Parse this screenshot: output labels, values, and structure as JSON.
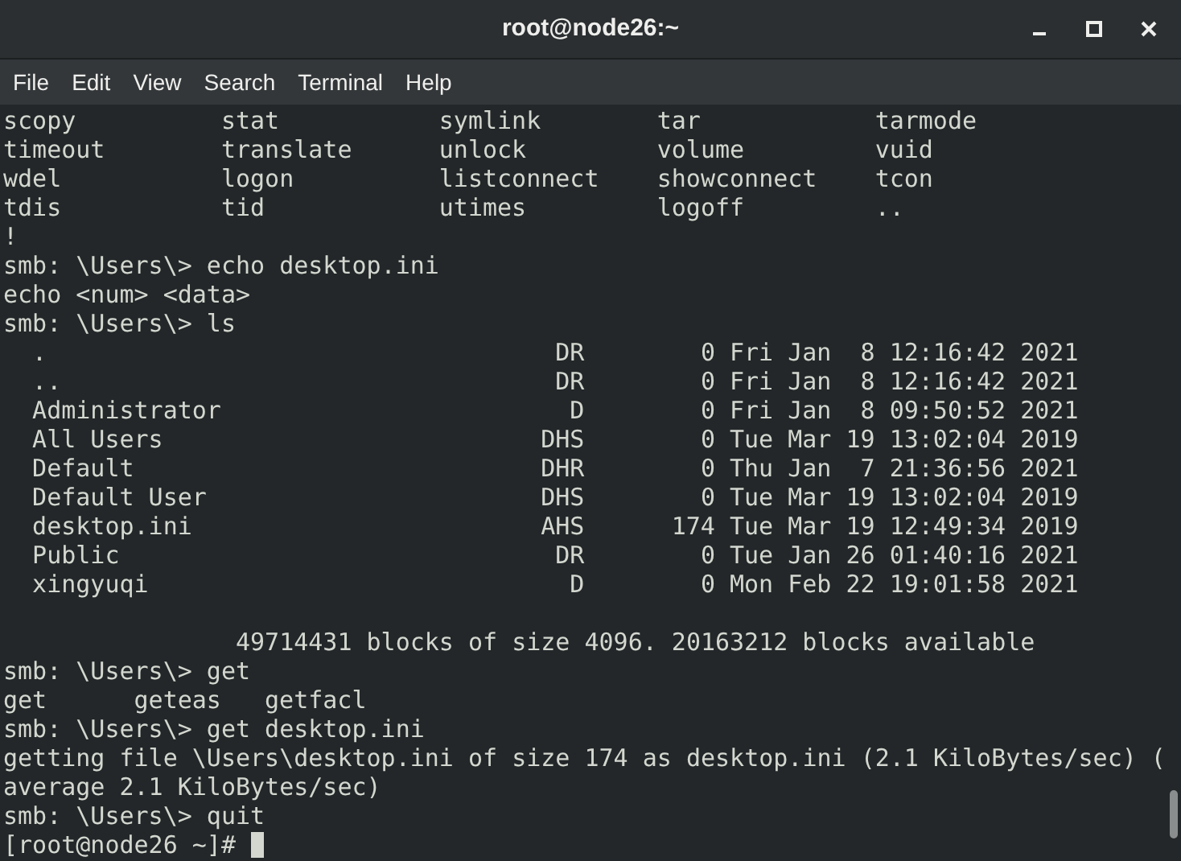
{
  "window": {
    "title": "root@node26:~"
  },
  "menu": [
    "File",
    "Edit",
    "View",
    "Search",
    "Terminal",
    "Help"
  ],
  "terminal": {
    "lines": [
      {
        "kind": "wide_columns",
        "cells": [
          "scopy",
          "stat",
          "symlink",
          "tar",
          "tarmode"
        ]
      },
      {
        "kind": "wide_columns",
        "cells": [
          "timeout",
          "translate",
          "unlock",
          "volume",
          "vuid"
        ]
      },
      {
        "kind": "wide_columns",
        "cells": [
          "wdel",
          "logon",
          "listconnect",
          "showconnect",
          "tcon"
        ]
      },
      {
        "kind": "wide_columns",
        "cells": [
          "tdis",
          "tid",
          "utimes",
          "logoff",
          ".."
        ]
      },
      {
        "kind": "text",
        "text": "!"
      },
      {
        "kind": "text",
        "text": "smb: \\Users\\> echo desktop.ini"
      },
      {
        "kind": "text",
        "text": "echo <num> <data>"
      },
      {
        "kind": "text",
        "text": "smb: \\Users\\> ls"
      },
      {
        "kind": "listing",
        "name": ".",
        "attributes": "DR",
        "size": "0",
        "date": "Fri Jan  8 12:16:42 2021"
      },
      {
        "kind": "listing",
        "name": "..",
        "attributes": "DR",
        "size": "0",
        "date": "Fri Jan  8 12:16:42 2021"
      },
      {
        "kind": "listing",
        "name": "Administrator",
        "attributes": "D",
        "size": "0",
        "date": "Fri Jan  8 09:50:52 2021"
      },
      {
        "kind": "listing",
        "name": "All Users",
        "attributes": "DHS",
        "size": "0",
        "date": "Tue Mar 19 13:02:04 2019"
      },
      {
        "kind": "listing",
        "name": "Default",
        "attributes": "DHR",
        "size": "0",
        "date": "Thu Jan  7 21:36:56 2021"
      },
      {
        "kind": "listing",
        "name": "Default User",
        "attributes": "DHS",
        "size": "0",
        "date": "Tue Mar 19 13:02:04 2019"
      },
      {
        "kind": "listing",
        "name": "desktop.ini",
        "attributes": "AHS",
        "size": "174",
        "date": "Tue Mar 19 12:49:34 2019"
      },
      {
        "kind": "listing",
        "name": "Public",
        "attributes": "DR",
        "size": "0",
        "date": "Tue Jan 26 01:40:16 2021"
      },
      {
        "kind": "listing",
        "name": "xingyuqi",
        "attributes": "D",
        "size": "0",
        "date": "Mon Feb 22 19:01:58 2021"
      },
      {
        "kind": "blank"
      },
      {
        "kind": "summary",
        "text": "49714431 blocks of size 4096. 20163212 blocks available"
      },
      {
        "kind": "text",
        "text": "smb: \\Users\\> get"
      },
      {
        "kind": "narrow_columns",
        "cells": [
          "get",
          "geteas",
          "getfacl"
        ]
      },
      {
        "kind": "text",
        "text": "smb: \\Users\\> get desktop.ini"
      },
      {
        "kind": "text",
        "text": "getting file \\Users\\desktop.ini of size 174 as desktop.ini (2.1 KiloBytes/sec) ("
      },
      {
        "kind": "text",
        "text": "average 2.1 KiloBytes/sec)"
      },
      {
        "kind": "text",
        "text": "smb: \\Users\\> quit"
      },
      {
        "kind": "prompt",
        "text": "[root@node26 ~]#",
        "cursor": true
      }
    ]
  }
}
